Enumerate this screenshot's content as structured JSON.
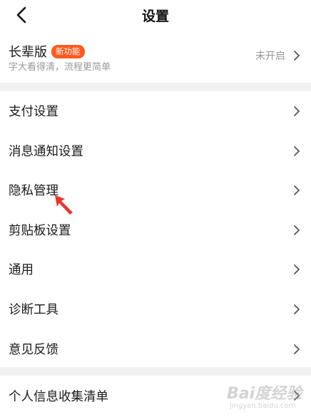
{
  "header": {
    "title": "设置",
    "back_icon": "chevron-left-icon"
  },
  "elder_mode": {
    "title": "长辈版",
    "badge": "新功能",
    "subtitle": "字大看得清，流程更简单",
    "status": "未开启",
    "badge_color": "#ff5a1f"
  },
  "settings": {
    "items": [
      {
        "label": "支付设置"
      },
      {
        "label": "消息通知设置"
      },
      {
        "label": "隐私管理"
      },
      {
        "label": "剪贴板设置"
      },
      {
        "label": "通用"
      },
      {
        "label": "诊断工具"
      },
      {
        "label": "意见反馈"
      }
    ],
    "bottom_item": {
      "label": "个人信息收集清单"
    }
  },
  "annotation": {
    "arrow_color": "#e8342f"
  },
  "watermark": {
    "text": "Bai度经验",
    "sub": "jingyan.baidu.com"
  }
}
